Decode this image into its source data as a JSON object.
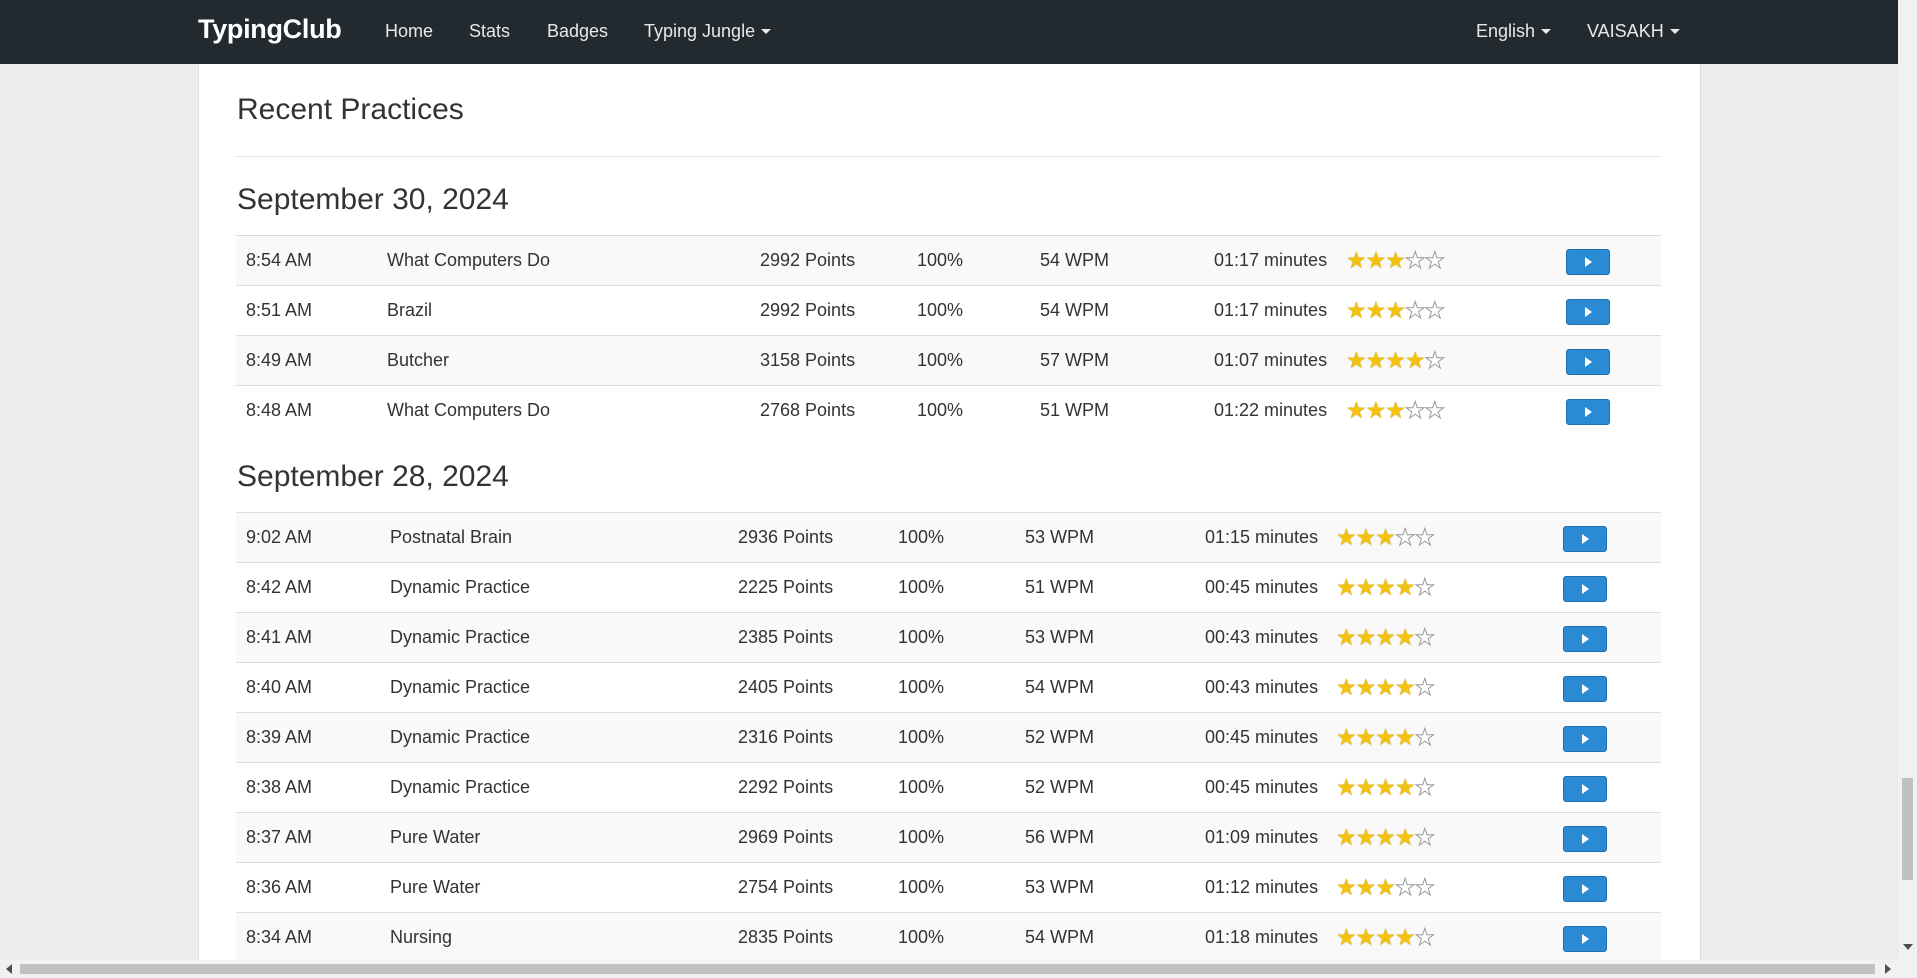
{
  "nav": {
    "brand": "TypingClub",
    "items": [
      "Home",
      "Stats",
      "Badges",
      "Typing Jungle"
    ],
    "language": "English",
    "user": "VAISAKH"
  },
  "page": {
    "title": "Recent Practices"
  },
  "colors": {
    "navbar": "#222a30",
    "play_button": "#2a8ad4",
    "star": "#f4c20d"
  },
  "icons": {
    "play": "play-icon",
    "star": "star-icon",
    "caret": "caret-down-icon"
  },
  "groups": [
    {
      "date": "September 30, 2024",
      "rows": [
        {
          "time": "8:54 AM",
          "lesson": "What Computers Do",
          "points": "2992 Points",
          "accuracy": "100%",
          "speed": "54 WPM",
          "duration": "01:17 minutes",
          "stars": 3
        },
        {
          "time": "8:51 AM",
          "lesson": "Brazil",
          "points": "2992 Points",
          "accuracy": "100%",
          "speed": "54 WPM",
          "duration": "01:17 minutes",
          "stars": 3
        },
        {
          "time": "8:49 AM",
          "lesson": "Butcher",
          "points": "3158 Points",
          "accuracy": "100%",
          "speed": "57 WPM",
          "duration": "01:07 minutes",
          "stars": 4
        },
        {
          "time": "8:48 AM",
          "lesson": "What Computers Do",
          "points": "2768 Points",
          "accuracy": "100%",
          "speed": "51 WPM",
          "duration": "01:22 minutes",
          "stars": 3
        }
      ]
    },
    {
      "date": "September 28, 2024",
      "rows": [
        {
          "time": "9:02 AM",
          "lesson": "Postnatal Brain",
          "points": "2936 Points",
          "accuracy": "100%",
          "speed": "53 WPM",
          "duration": "01:15 minutes",
          "stars": 3
        },
        {
          "time": "8:42 AM",
          "lesson": "Dynamic Practice",
          "points": "2225 Points",
          "accuracy": "100%",
          "speed": "51 WPM",
          "duration": "00:45 minutes",
          "stars": 4
        },
        {
          "time": "8:41 AM",
          "lesson": "Dynamic Practice",
          "points": "2385 Points",
          "accuracy": "100%",
          "speed": "53 WPM",
          "duration": "00:43 minutes",
          "stars": 4
        },
        {
          "time": "8:40 AM",
          "lesson": "Dynamic Practice",
          "points": "2405 Points",
          "accuracy": "100%",
          "speed": "54 WPM",
          "duration": "00:43 minutes",
          "stars": 4
        },
        {
          "time": "8:39 AM",
          "lesson": "Dynamic Practice",
          "points": "2316 Points",
          "accuracy": "100%",
          "speed": "52 WPM",
          "duration": "00:45 minutes",
          "stars": 4
        },
        {
          "time": "8:38 AM",
          "lesson": "Dynamic Practice",
          "points": "2292 Points",
          "accuracy": "100%",
          "speed": "52 WPM",
          "duration": "00:45 minutes",
          "stars": 4
        },
        {
          "time": "8:37 AM",
          "lesson": "Pure Water",
          "points": "2969 Points",
          "accuracy": "100%",
          "speed": "56 WPM",
          "duration": "01:09 minutes",
          "stars": 4
        },
        {
          "time": "8:36 AM",
          "lesson": "Pure Water",
          "points": "2754 Points",
          "accuracy": "100%",
          "speed": "53 WPM",
          "duration": "01:12 minutes",
          "stars": 3
        },
        {
          "time": "8:34 AM",
          "lesson": "Nursing",
          "points": "2835 Points",
          "accuracy": "100%",
          "speed": "54 WPM",
          "duration": "01:18 minutes",
          "stars": 4
        }
      ]
    }
  ]
}
